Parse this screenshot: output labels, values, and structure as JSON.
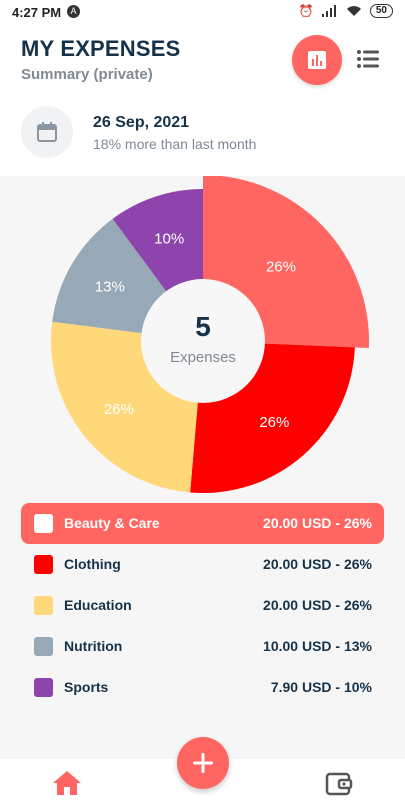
{
  "status": {
    "time": "4:27 PM",
    "battery": "50"
  },
  "header": {
    "title": "MY EXPENSES",
    "subtitle": "Summary (private)"
  },
  "date_info": {
    "date": "26 Sep, 2021",
    "comparison": "18% more than last month"
  },
  "chart_data": {
    "type": "pie",
    "center_value": "5",
    "center_label": "Expenses",
    "categories": [
      "Beauty & Care",
      "Clothing",
      "Education",
      "Nutrition",
      "Sports"
    ],
    "values": [
      20.0,
      20.0,
      20.0,
      10.0,
      7.9
    ],
    "percent_labels": [
      "26%",
      "26%",
      "26%",
      "13%",
      "10%"
    ],
    "colors": [
      "#ff6661",
      "#ff0000",
      "#ffd87a",
      "#97a8b6",
      "#8e44ad"
    ],
    "selected": "Beauty & Care"
  },
  "legend": [
    {
      "label": "Beauty & Care",
      "value": "20.00 USD - 26%",
      "color": "#ffffff",
      "selected": true
    },
    {
      "label": "Clothing",
      "value": "20.00 USD - 26%",
      "color": "#ff0000",
      "selected": false
    },
    {
      "label": "Education",
      "value": "20.00 USD - 26%",
      "color": "#ffd87a",
      "selected": false
    },
    {
      "label": "Nutrition",
      "value": "10.00 USD - 13%",
      "color": "#97a8b6",
      "selected": false
    },
    {
      "label": "Sports",
      "value": "7.90 USD - 10%",
      "color": "#8e44ad",
      "selected": false
    }
  ],
  "icons": {
    "chart_button": "bar-chart-icon",
    "menu_button": "list-menu-icon",
    "calendar": "calendar-icon",
    "add": "plus-icon",
    "home": "home-icon",
    "wallet": "wallet-icon"
  },
  "accent": "#ff6661"
}
